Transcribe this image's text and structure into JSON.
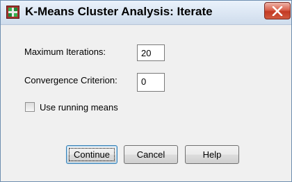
{
  "window": {
    "title": "K-Means Cluster Analysis: Iterate",
    "app_icon": "spss-dialog-icon",
    "close_icon": "close-icon"
  },
  "form": {
    "max_iterations": {
      "label": "Maximum Iterations:",
      "value": "20"
    },
    "convergence": {
      "label": "Convergence Criterion:",
      "value": "0"
    },
    "running_means": {
      "label": "Use running means",
      "checked": false
    }
  },
  "buttons": {
    "continue": "Continue",
    "cancel": "Cancel",
    "help": "Help"
  },
  "colors": {
    "close_button": "#c43a24",
    "default_button_border": "#3c7fb1"
  }
}
